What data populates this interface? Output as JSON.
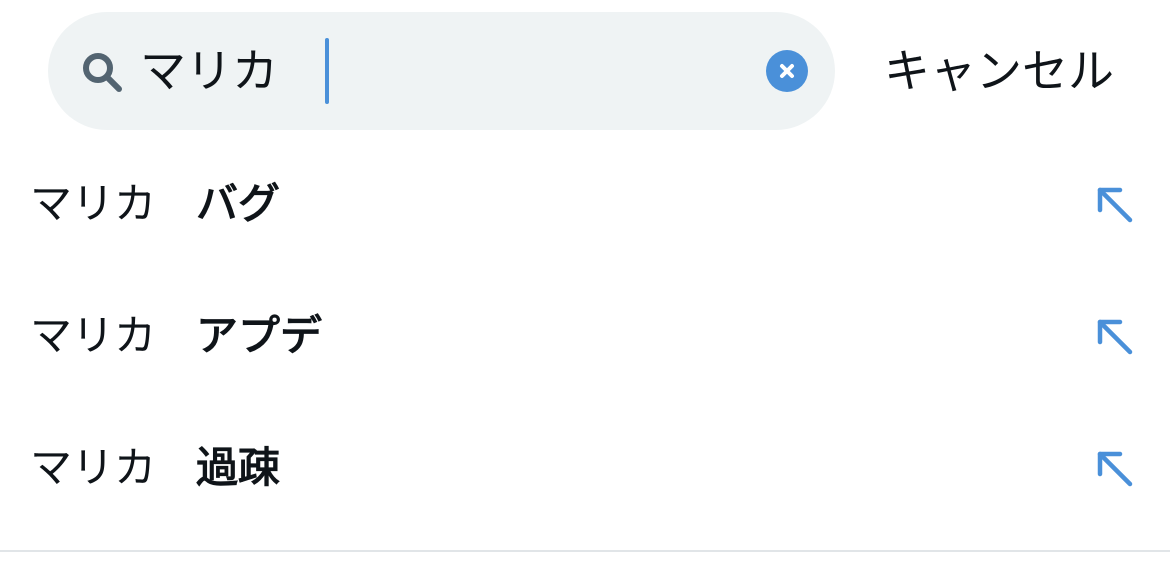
{
  "search": {
    "query": "マリカ",
    "clear_icon": "close-circle-icon",
    "search_icon": "magnifier-icon",
    "cancel_label": "キャンセル",
    "accent_color": "#4a90d9"
  },
  "suggestions": [
    {
      "query": "マリカ",
      "completion": "バグ",
      "icon": "arrow-up-left-icon"
    },
    {
      "query": "マリカ",
      "completion": "アプデ",
      "icon": "arrow-up-left-icon"
    },
    {
      "query": "マリカ",
      "completion": "過疎",
      "icon": "arrow-up-left-icon"
    }
  ]
}
